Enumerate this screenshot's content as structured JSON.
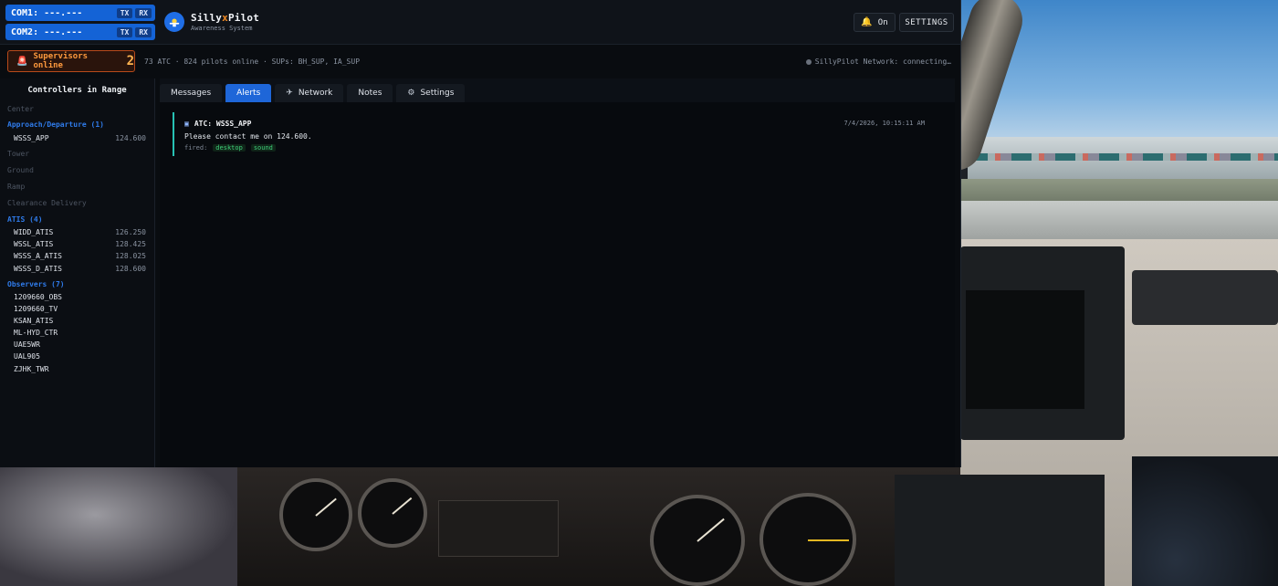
{
  "com": [
    {
      "label": "COM1: ---.---",
      "tx": "TX",
      "rx": "RX"
    },
    {
      "label": "COM2: ---.---",
      "tx": "TX",
      "rx": "RX"
    }
  ],
  "brand": {
    "name_a": "Silly",
    "name_x": "x",
    "name_b": "Pilot",
    "subtitle": "Awareness System"
  },
  "header": {
    "bell_label": "On",
    "settings_label": "SETTINGS"
  },
  "supervisors": {
    "label": "Supervisors online",
    "count": "2"
  },
  "stats": "73 ATC · 824 pilots online · SUPs: BH_SUP, IA_SUP",
  "network_status": "SillyPilot Network: connecting…",
  "sidebar": {
    "title": "Controllers in Range",
    "groups": {
      "center": "Center",
      "approach": "Approach/Departure (1)",
      "tower": "Tower",
      "ground": "Ground",
      "ramp": "Ramp",
      "clearance": "Clearance Delivery",
      "atis": "ATIS (4)",
      "observers": "Observers (7)"
    },
    "approach_items": [
      {
        "call": "WSSS_APP",
        "freq": "124.600"
      }
    ],
    "atis_items": [
      {
        "call": "WIDD_ATIS",
        "freq": "126.250"
      },
      {
        "call": "WSSL_ATIS",
        "freq": "128.425"
      },
      {
        "call": "WSSS_A_ATIS",
        "freq": "128.025"
      },
      {
        "call": "WSSS_D_ATIS",
        "freq": "128.600"
      }
    ],
    "observer_items": [
      "1209660_OBS",
      "1209660_TV",
      "KSAN_ATIS",
      "ML-HYD_CTR",
      "UAE5WR",
      "UAL905",
      "ZJHK_TWR"
    ]
  },
  "tabs": {
    "messages": "Messages",
    "alerts": "Alerts",
    "network": "Network",
    "notes": "Notes",
    "settings": "Settings"
  },
  "alert": {
    "title": "ATC: WSSS_APP",
    "time": "7/4/2026, 10:15:11 AM",
    "message": "Please contact me on 124.600.",
    "fired_label": "fired:",
    "chips": [
      "desktop",
      "sound"
    ]
  },
  "colors": {
    "accent": "#1e66d8",
    "alert_border": "#27c2b4",
    "supervisor": "#ff9a3d",
    "chip": "#3fd07a"
  }
}
